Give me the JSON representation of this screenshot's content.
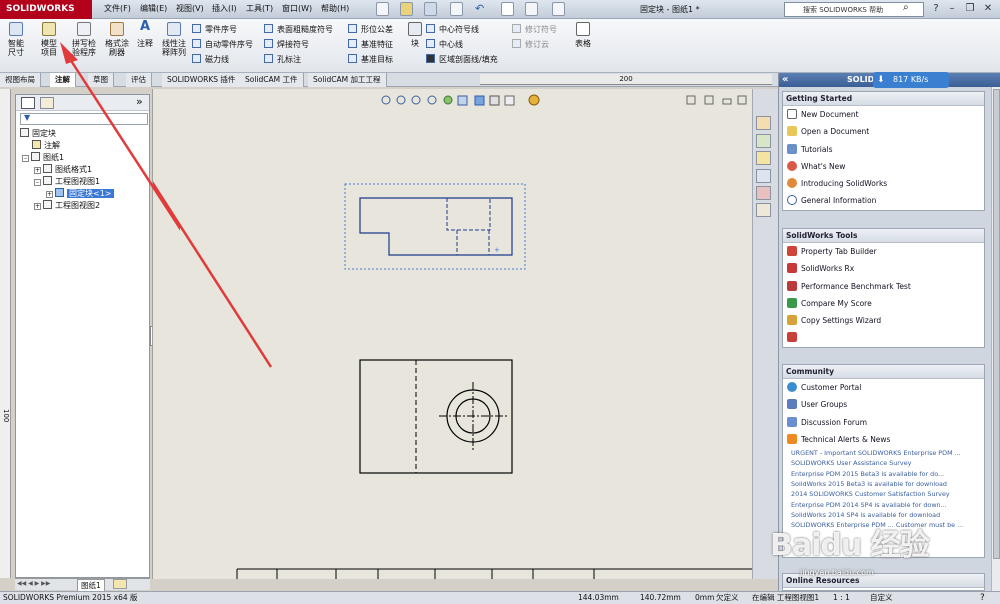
{
  "app": {
    "logo": "SOLIDWORKS",
    "doc_title": "固定块 - 图纸1 *"
  },
  "menu": [
    "文件(F)",
    "编辑(E)",
    "视图(V)",
    "插入(I)",
    "工具(T)",
    "窗口(W)",
    "帮助(H)"
  ],
  "search": {
    "placeholder": "搜索 SOLIDWORKS 帮助"
  },
  "toolbar": {
    "big": [
      "智能尺寸",
      "模型项目",
      "拼写检验程序",
      "格式涂刷器",
      "注释",
      "线性注释阵列",
      "块",
      "表格"
    ],
    "col1": [
      "零件序号",
      "自动零件序号",
      "磁力线"
    ],
    "col2": [
      "表面粗糙度符号",
      "焊接符号",
      "孔标注"
    ],
    "col3": [
      "形位公差",
      "基准特征",
      "基准目标"
    ],
    "col4": [
      "中心符号线",
      "中心线",
      "区域剖面线/填充"
    ],
    "col5": [
      "修订符号",
      "修订云"
    ]
  },
  "tabs": [
    "视图布局",
    "注解",
    "草图",
    "评估",
    "SOLIDWORKS 插件",
    "SolidCAM 工件",
    "SolidCAM 加工工程"
  ],
  "ruler": {
    "top": "200",
    "left": "100"
  },
  "tree": {
    "root": "固定块",
    "annotations": "注解",
    "sheet": "图纸1",
    "sheet_format": "图纸格式1",
    "view1": "工程图视图1",
    "part": "固定块<1>",
    "view2": "工程图视图2"
  },
  "sheet_tab": "图纸1",
  "taskpane": {
    "title": "SOLIDWORKS",
    "speed": "817 KB/s",
    "getting_started": {
      "title": "Getting Started",
      "items": [
        "New Document",
        "Open a Document",
        "Tutorials",
        "What's New",
        "Introducing SolidWorks",
        "General Information"
      ]
    },
    "tools": {
      "title": "SolidWorks Tools",
      "items": [
        "Property Tab Builder",
        "SolidWorks Rx",
        "Performance Benchmark Test",
        "Compare My Score",
        "Copy Settings Wizard"
      ]
    },
    "community": {
      "title": "Community",
      "items": [
        "Customer Portal",
        "User Groups",
        "Discussion Forum",
        "Technical Alerts & News"
      ]
    },
    "news": [
      "URGENT - Important SOLIDWORKS Enterprise PDM ...",
      "SOLIDWORKS User Assistance Survey",
      "Enterprise PDM 2015 Beta3 is available for do...",
      "SolidWorks 2015 Beta3 is available for download",
      "2014 SOLIDWORKS Customer Satisfaction Survey",
      "Enterprise PDM 2014 SP4 is available for down...",
      "SolidWorks 2014 SP4 is available for download",
      "SOLIDWORKS Enterprise PDM ... Customer must be ..."
    ],
    "online": "Online Resources"
  },
  "status": {
    "product": "SOLIDWORKS Premium 2015 x64 版",
    "x": "144.03mm",
    "y": "140.72mm",
    "z": "0mm",
    "state": "欠定义",
    "editing": "在编辑 工程图视图1",
    "scale": "1 : 1",
    "custom": "自定义"
  },
  "watermark": {
    "text": "Baidu 经验",
    "url": "jingyan.baidu.com"
  }
}
